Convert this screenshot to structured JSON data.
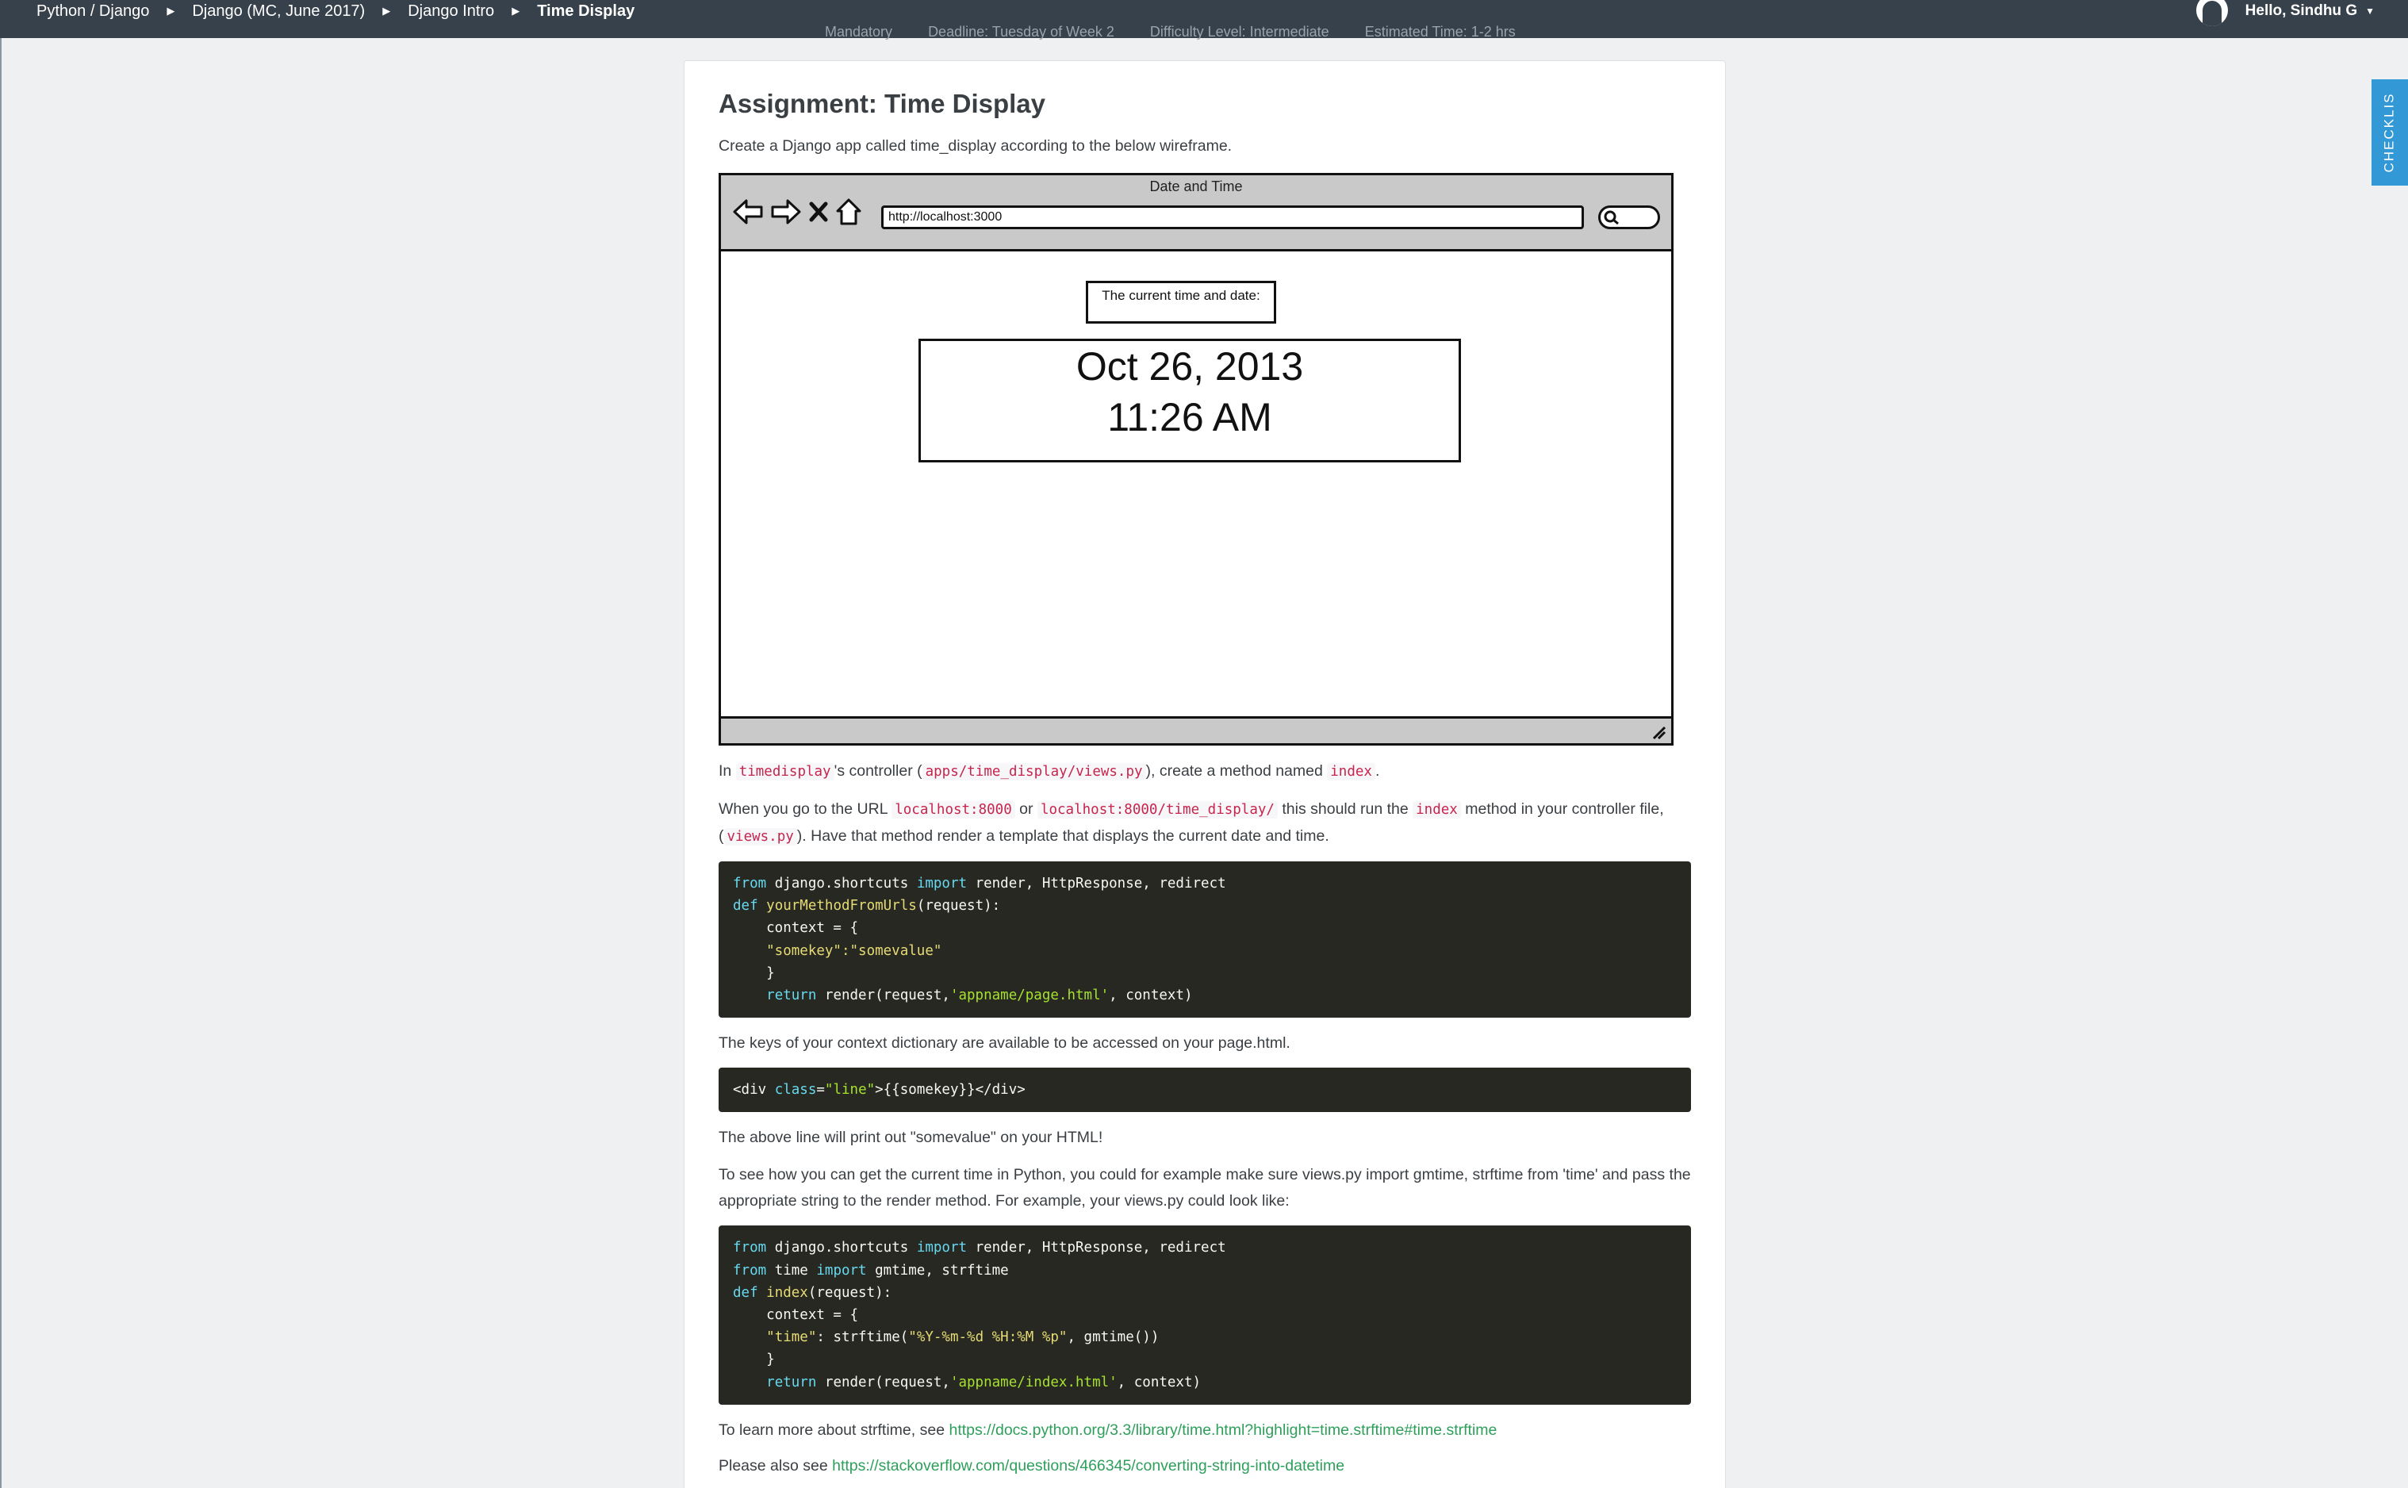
{
  "nav": {
    "breadcrumbs": [
      "Python / Django",
      "Django (MC, June 2017)",
      "Django Intro",
      "Time Display"
    ],
    "user_greeting": "Hello, Sindhu G"
  },
  "checklist_tab": "CHECKLIS",
  "meta_cut": [
    "Mandatory",
    "Deadline: Tuesday of Week 2",
    "Difficulty Level: Intermediate",
    "Estimated Time: 1-2 hrs"
  ],
  "assignment": {
    "title": "Assignment: Time Display",
    "intro": "Create a Django app called time_display according to the below wireframe."
  },
  "wireframe": {
    "window_title": "Date and Time",
    "url": "http://localhost:3000",
    "label": "The current time and date:",
    "date": "Oct 26, 2013",
    "time": "11:26 AM"
  },
  "para1": {
    "a": "In ",
    "code1": "timedisplay",
    "b": "'s controller (",
    "code2": "apps/time_display/views.py",
    "c": "), create a method named ",
    "code3": "index",
    "d": "."
  },
  "para2": {
    "a": "When you go to the URL ",
    "code1": "localhost:8000",
    "b": " or ",
    "code2": "localhost:8000/time_display/",
    "c": " this should run the ",
    "code3": "index",
    "d": " method in your controller file, (",
    "code4": "views.py",
    "e": "). Have that method render a template that displays the current date and time."
  },
  "code1": {
    "l1": [
      "from",
      " django.shortcuts ",
      "import",
      " render, HttpResponse, redirect"
    ],
    "l2": [
      "def",
      " ",
      "yourMethodFromUrls",
      "(request):"
    ],
    "l3": "    context = {",
    "l4": "    \"somekey\":\"somevalue\"",
    "l5": "    }",
    "l6": [
      "    ",
      "return",
      " render(request,",
      "'appname/page.html'",
      ", context)"
    ]
  },
  "para3": "The keys of your context dictionary are available to be accessed on your page.html.",
  "code2": [
    "<div ",
    "class",
    "=",
    "\"line\"",
    ">{{somekey}}</div>"
  ],
  "para4": "The above line will print out \"somevalue\" on your HTML!",
  "para5": "To see how you can get the current time in Python, you could for example make sure views.py import gmtime, strftime from 'time' and pass the appropriate string to the render method.  For example, your views.py could look like:",
  "code3": {
    "l1": [
      "from",
      " django.shortcuts ",
      "import",
      " render, HttpResponse, redirect"
    ],
    "l2": [
      "from",
      " time ",
      "import",
      " gmtime, strftime"
    ],
    "l3": [
      "def",
      " ",
      "index",
      "(request):"
    ],
    "l4": "    context = {",
    "l5": [
      "    ",
      "\"time\"",
      ": strftime(",
      "\"%Y-%m-%d %H:%M %p\"",
      ", gmtime())"
    ],
    "l6": "    }",
    "l7": [
      "    ",
      "return",
      " render(request,",
      "'appname/index.html'",
      ", context)"
    ]
  },
  "para6": {
    "a": "To learn more about strftime, see ",
    "link": "https://docs.python.org/3.3/library/time.html?highlight=time.strftime#time.strftime"
  },
  "para7": {
    "a": "Please also see ",
    "link": "https://stackoverflow.com/questions/466345/converting-string-into-datetime"
  }
}
